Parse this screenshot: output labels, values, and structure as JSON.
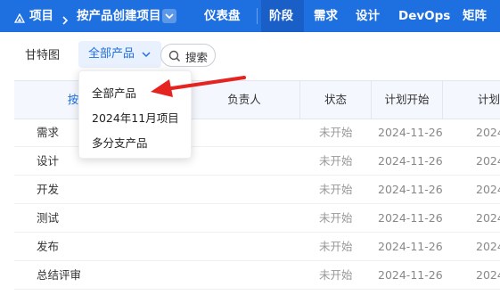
{
  "topbar": {
    "project_label": "项目",
    "breadcrumb_current": "按产品创建项目",
    "nav": [
      "仪表盘",
      "阶段",
      "需求",
      "设计",
      "DevOps",
      "矩阵"
    ],
    "active_tab": "阶段"
  },
  "toolbar": {
    "gantt_label": "甘特图",
    "product_select_value": "全部产品",
    "search_label": "搜索"
  },
  "product_dropdown": {
    "options": [
      "全部产品",
      "2024年11月项目",
      "多分支产品"
    ]
  },
  "table": {
    "columns": [
      "按",
      "负责人",
      "状态",
      "计划开始",
      "计划"
    ],
    "rows": [
      {
        "name": "需求",
        "status": "未开始",
        "plan_start": "2024-11-26",
        "plan_end": "2024"
      },
      {
        "name": "设计",
        "status": "未开始",
        "plan_start": "2024-11-26",
        "plan_end": "2024"
      },
      {
        "name": "开发",
        "status": "未开始",
        "plan_start": "2024-11-26",
        "plan_end": "2024"
      },
      {
        "name": "测试",
        "status": "未开始",
        "plan_start": "2024-11-26",
        "plan_end": "2024"
      },
      {
        "name": "发布",
        "status": "未开始",
        "plan_start": "2024-11-26",
        "plan_end": "2024"
      },
      {
        "name": "总结评审",
        "status": "未开始",
        "plan_start": "2024-11-26",
        "plan_end": "2024"
      }
    ]
  },
  "colors": {
    "brand": "#1e6fe0",
    "annotation": "#e52421"
  },
  "icons": [
    "project-icon",
    "chevron-right-icon",
    "chevron-down-icon",
    "search-icon",
    "annotation-arrow"
  ]
}
